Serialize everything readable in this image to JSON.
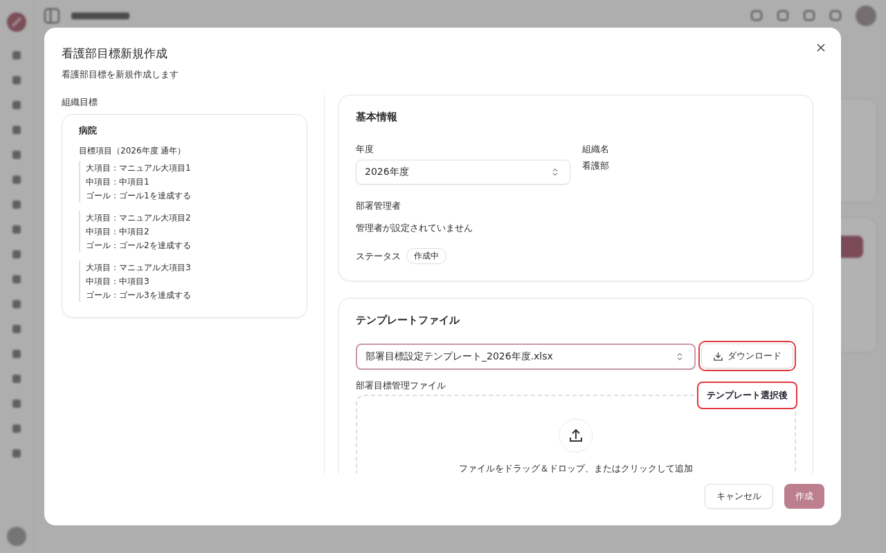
{
  "dialog": {
    "title": "看護部目標新規作成",
    "subtitle": "看護部目標を新規作成します"
  },
  "org_goals": {
    "label": "組織目標",
    "org": "病院",
    "heading": "目標項目（2026年度 通年）",
    "groups": [
      {
        "lines": [
          "大項目：マニュアル大項目1",
          "中項目：中項目1",
          "ゴール：ゴール1を達成する"
        ]
      },
      {
        "lines": [
          "大項目：マニュアル大項目2",
          "中項目：中項目2",
          "ゴール：ゴール2を達成する"
        ]
      },
      {
        "lines": [
          "大項目：マニュアル大項目3",
          "中項目：中項目3",
          "ゴール：ゴール3を達成する"
        ]
      }
    ]
  },
  "basic_info": {
    "title": "基本情報",
    "year": {
      "label": "年度",
      "value": "2026年度"
    },
    "org_name": {
      "label": "組織名",
      "value": "看護部"
    },
    "manager": {
      "label": "部署管理者",
      "value": "管理者が設定されていません"
    },
    "status": {
      "label": "ステータス",
      "value": "作成中"
    }
  },
  "template": {
    "title": "テンプレートファイル",
    "select": {
      "value": "部署目標設定テンプレート_2026年度.xlsx"
    },
    "download_button": "ダウンロード",
    "tooltip": "テンプレート選択後",
    "upload": {
      "label": "部署目標管理ファイル",
      "hint": "ファイルをドラッグ＆ドロップ、またはクリックして追加"
    }
  },
  "footer": {
    "cancel": "キャンセル",
    "submit": "作成"
  }
}
